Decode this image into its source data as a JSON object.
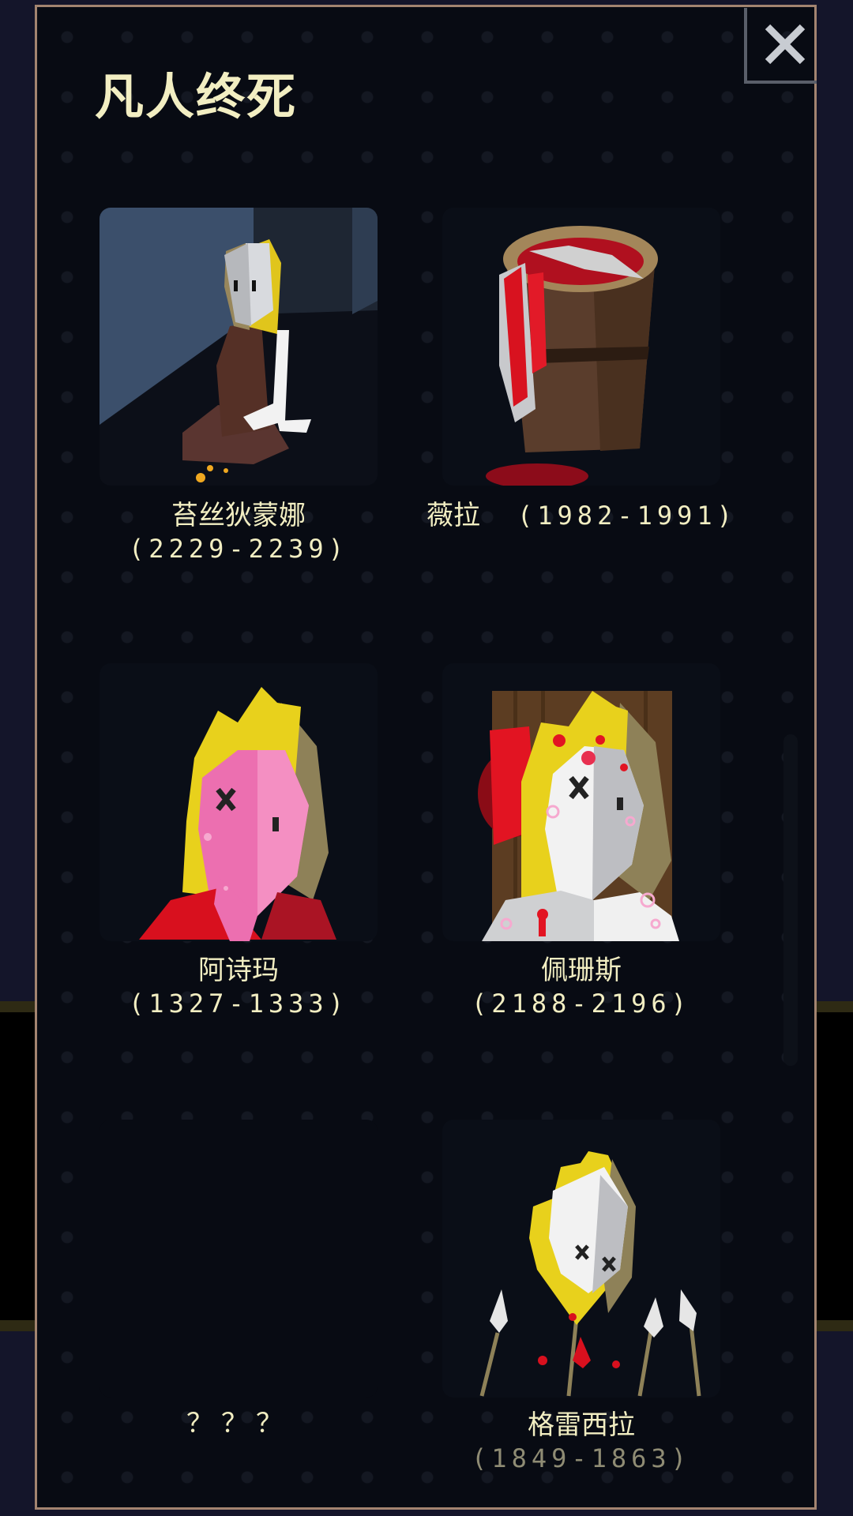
{
  "title": "凡人终死",
  "close_icon": "close-x-icon",
  "colors": {
    "panel_border": "#a38470",
    "text": "#f2eec2",
    "text_dim": "#8f8c74",
    "panel_bg": "#080b13"
  },
  "cards": [
    {
      "name": "苔丝狄蒙娜",
      "dates": "(2229-2239)",
      "icon": "kneeling-girl-portrait"
    },
    {
      "name": "薇拉",
      "dates": "(1982-1991)",
      "icon": "bucket-of-blood-portrait"
    },
    {
      "name": "阿诗玛",
      "dates": "(1327-1333)",
      "icon": "pink-faced-girl-portrait"
    },
    {
      "name": "佩珊斯",
      "dates": "(2188-2196)",
      "icon": "bloody-faced-girl-portrait"
    },
    {
      "name": "？？？",
      "dates": "",
      "icon": "locked-portrait"
    },
    {
      "name": "格雷西拉",
      "dates": "(1849-1863)",
      "icon": "head-on-spears-portrait"
    }
  ]
}
